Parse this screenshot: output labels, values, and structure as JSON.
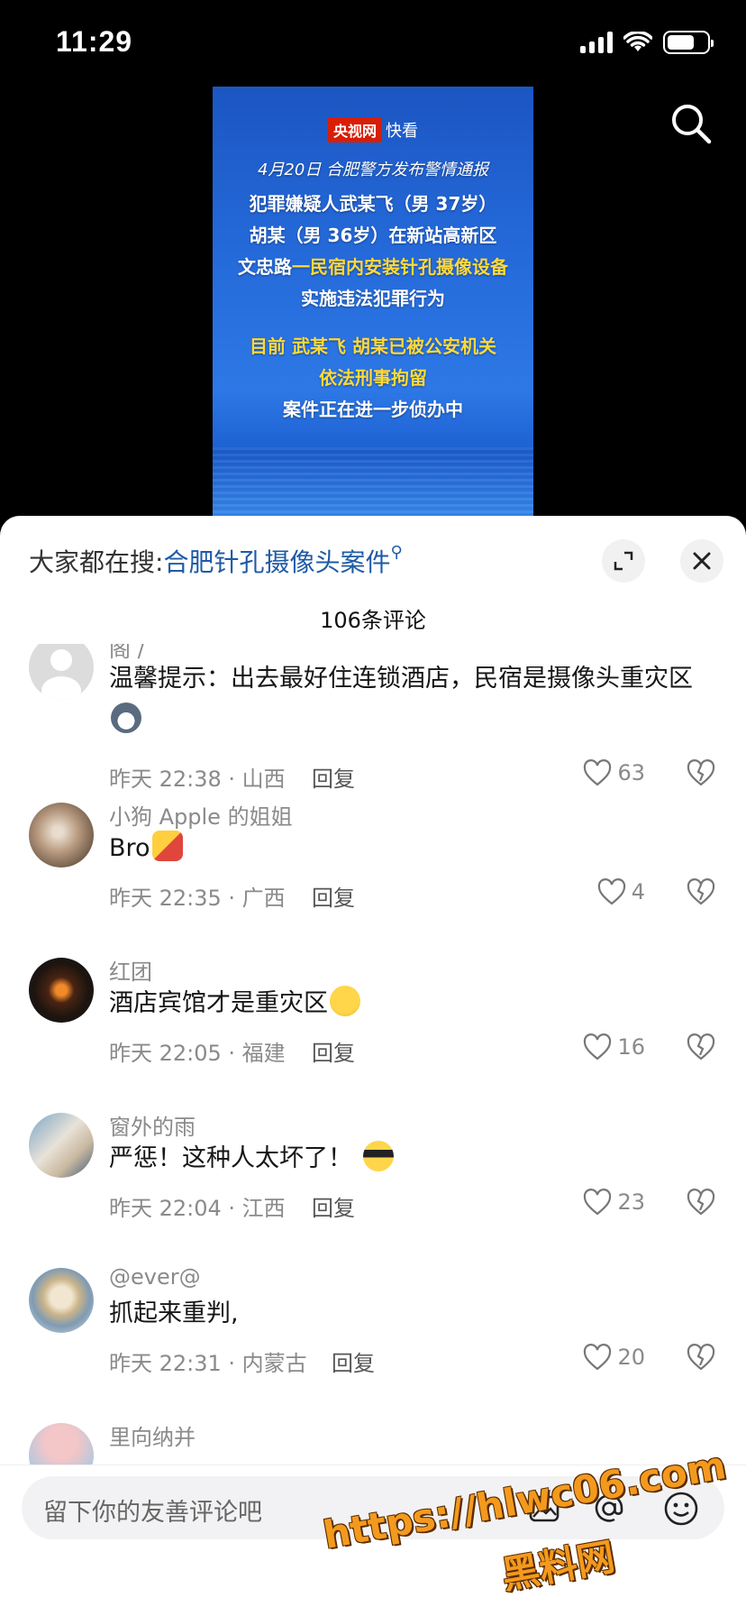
{
  "status_bar": {
    "time": "11:29"
  },
  "video": {
    "logo_cctv": "央视网",
    "logo_kk": "快看",
    "lines": [
      "4月20日 合肥警方发布警情通报",
      "犯罪嫌疑人武某飞（男 37岁）",
      "胡某（男 36岁）在新站高新区",
      "文忠路",
      "一民宿内安装针孔摄像设备",
      "实施违法犯罪行为",
      "目前 武某飞 胡某已被公安机关",
      "依法刑事拘留",
      "案件正在进一步侦办中"
    ]
  },
  "sheet": {
    "hot_search_prefix": "大家都在搜:",
    "hot_search_link": "合肥针孔摄像头案件",
    "comment_count": "106条评论"
  },
  "comments": [
    {
      "username": "阁 /",
      "text": "温馨提示：出去最好住连锁酒店，民宿是摄像头重灾区",
      "time": "昨天 22:38 · 山西",
      "reply": "回复",
      "likes": "63"
    },
    {
      "username": "小狗 Apple 的姐姐",
      "text": "Bro",
      "time": "昨天 22:35 · 广西",
      "reply": "回复",
      "likes": "4"
    },
    {
      "username": "红团",
      "text": "酒店宾馆才是重灾区",
      "time": "昨天 22:05 · 福建",
      "reply": "回复",
      "likes": "16"
    },
    {
      "username": "窗外的雨",
      "text": "严惩！这种人太坏了！",
      "time": "昨天 22:04 · 江西",
      "reply": "回复",
      "likes": "23"
    },
    {
      "username": "@ever@",
      "text": "抓起来重判,",
      "time": "昨天 22:31 · 内蒙古",
      "reply": "回复",
      "likes": "20"
    },
    {
      "username": "里向纳并"
    }
  ],
  "bottom": {
    "placeholder": "留下你的友善评论吧",
    "watermark_url": "https://hlwc06.com",
    "watermark_name": "黑料网"
  }
}
